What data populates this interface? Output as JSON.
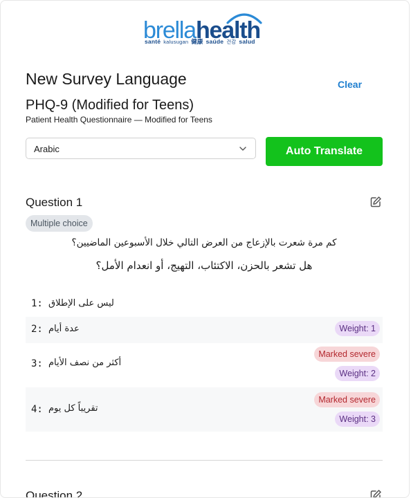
{
  "logo": {
    "word_a": "brella",
    "word_b": "health",
    "tagline": [
      "santé",
      "kalusugan",
      "健康",
      "saúde",
      "건강",
      "salud"
    ],
    "colors": {
      "light": "#2b8ad6",
      "dark": "#1a4d8c"
    }
  },
  "header": {
    "title": "New Survey Language",
    "clear_label": "Clear",
    "survey_name": "PHQ-9 (Modified for Teens)",
    "survey_subtitle": "Patient Health Questionnaire — Modified for Teens"
  },
  "language": {
    "selected": "Arabic",
    "translate_label": "Auto Translate",
    "translate_color": "#13c21c"
  },
  "questions": [
    {
      "title": "Question 1",
      "type": "Multiple choice",
      "prompt": "كم مرة شعرت بالإزعاج من العرض التالي خلال الأسبوعين الماضيين؟",
      "text": "هل تشعر بالحزن، الاكتئاب، التهيج، أو انعدام الأمل؟",
      "answers": [
        {
          "num": "1:",
          "text": "ليس على الإطلاق"
        },
        {
          "num": "2:",
          "text": "عدة أيام",
          "weight": "Weight: 1"
        },
        {
          "num": "3:",
          "text": "أكثر من نصف الأيام",
          "severe": "Marked severe",
          "weight": "Weight: 2"
        },
        {
          "num": "4:",
          "text": "تقريباً كل يوم",
          "severe": "Marked severe",
          "weight": "Weight: 3"
        }
      ]
    },
    {
      "title": "Question 2"
    }
  ],
  "icons": {
    "edit": "pencil-edit-icon",
    "dropdown": "chevron-down-icon"
  }
}
